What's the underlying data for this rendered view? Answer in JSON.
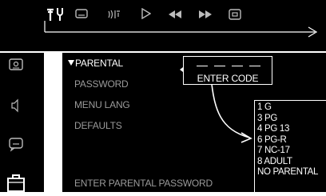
{
  "toolbar": {
    "icons": [
      "setup-icon",
      "subtitle-icon",
      "audio-icon",
      "play-icon",
      "rewind-icon",
      "fast-forward-icon",
      "display-icon"
    ]
  },
  "sidebar": {
    "icons": [
      "disc-icon",
      "speaker-icon",
      "subtitle-icon",
      "lock-icon"
    ]
  },
  "menu": {
    "items": [
      {
        "label": "PARENTAL",
        "active": true
      },
      {
        "label": "PASSWORD",
        "active": false
      },
      {
        "label": "MENU LANG",
        "active": false
      },
      {
        "label": "DEFAULTS",
        "active": false
      }
    ]
  },
  "code_entry": {
    "label": "ENTER CODE",
    "slots": 4
  },
  "ratings": {
    "options": [
      "1 G",
      "3 PG",
      "4 PG 13",
      "6 PG-R",
      "7 NC-17",
      "8 ADULT",
      "NO PARENTAL"
    ]
  },
  "prompt": "ENTER PARENTAL PASSWORD",
  "colors": {
    "background": "#000000",
    "text": "#ffffff",
    "inactive_text": "#9a9a9a",
    "frame": "#ffffff"
  }
}
